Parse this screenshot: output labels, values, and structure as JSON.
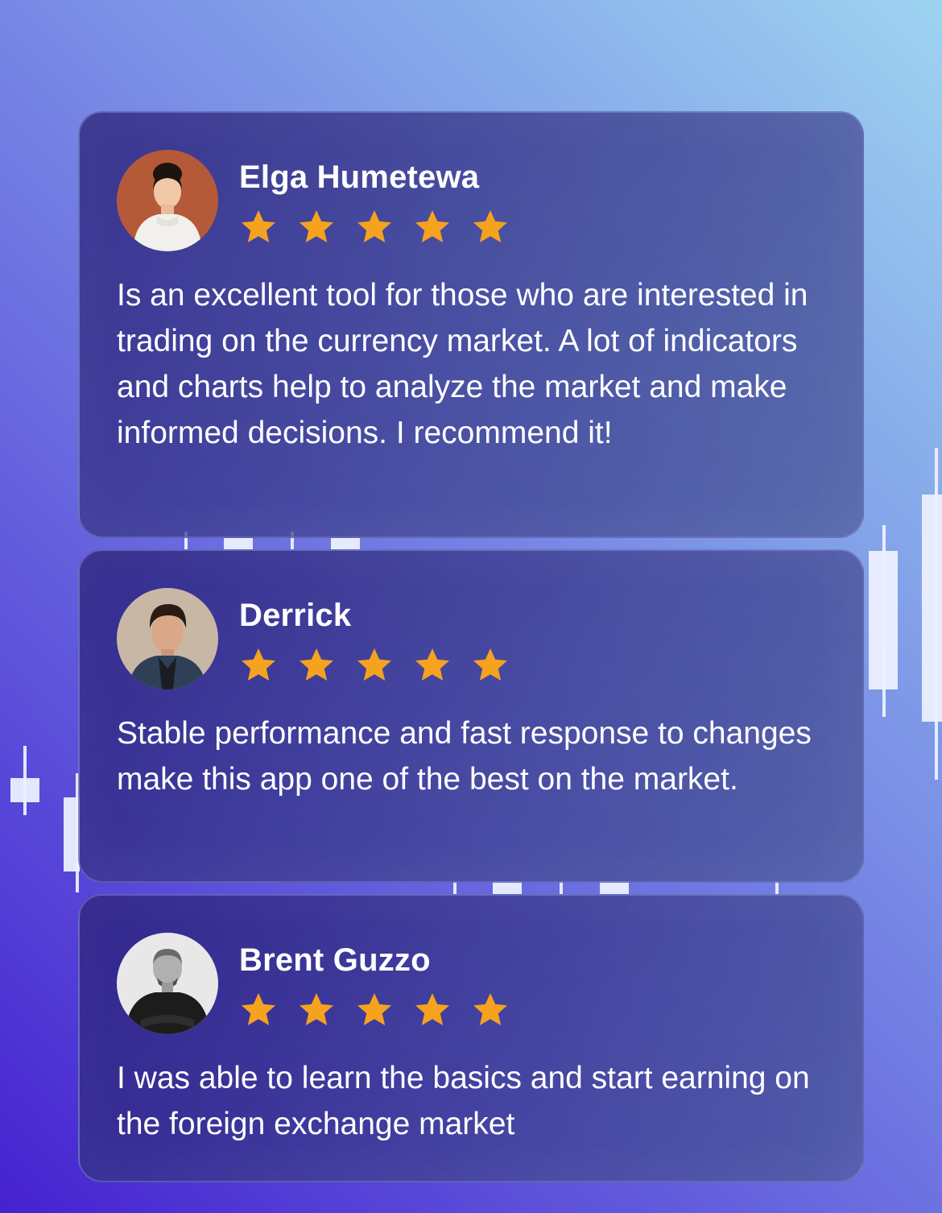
{
  "colors": {
    "star": "#f5a21f",
    "card_text": "#ffffff",
    "background_from": "#4522d0",
    "background_to": "#9ed3f0"
  },
  "reviews": [
    {
      "name": "Elga Humetewa",
      "rating": 5,
      "text": "Is an excellent tool for those who are interested in trading on the currency market. A lot of indicators and charts help to analyze the market and make informed decisions. I recommend it!",
      "avatar_icon": "woman-portrait"
    },
    {
      "name": "Derrick",
      "rating": 5,
      "text": "Stable performance and fast response to changes make this app one of the best on the market.",
      "avatar_icon": "man-portrait"
    },
    {
      "name": "Brent Guzzo",
      "rating": 5,
      "text": "I was able to learn the basics and start earning on the foreign exchange market",
      "avatar_icon": "man-portrait-bw"
    }
  ]
}
